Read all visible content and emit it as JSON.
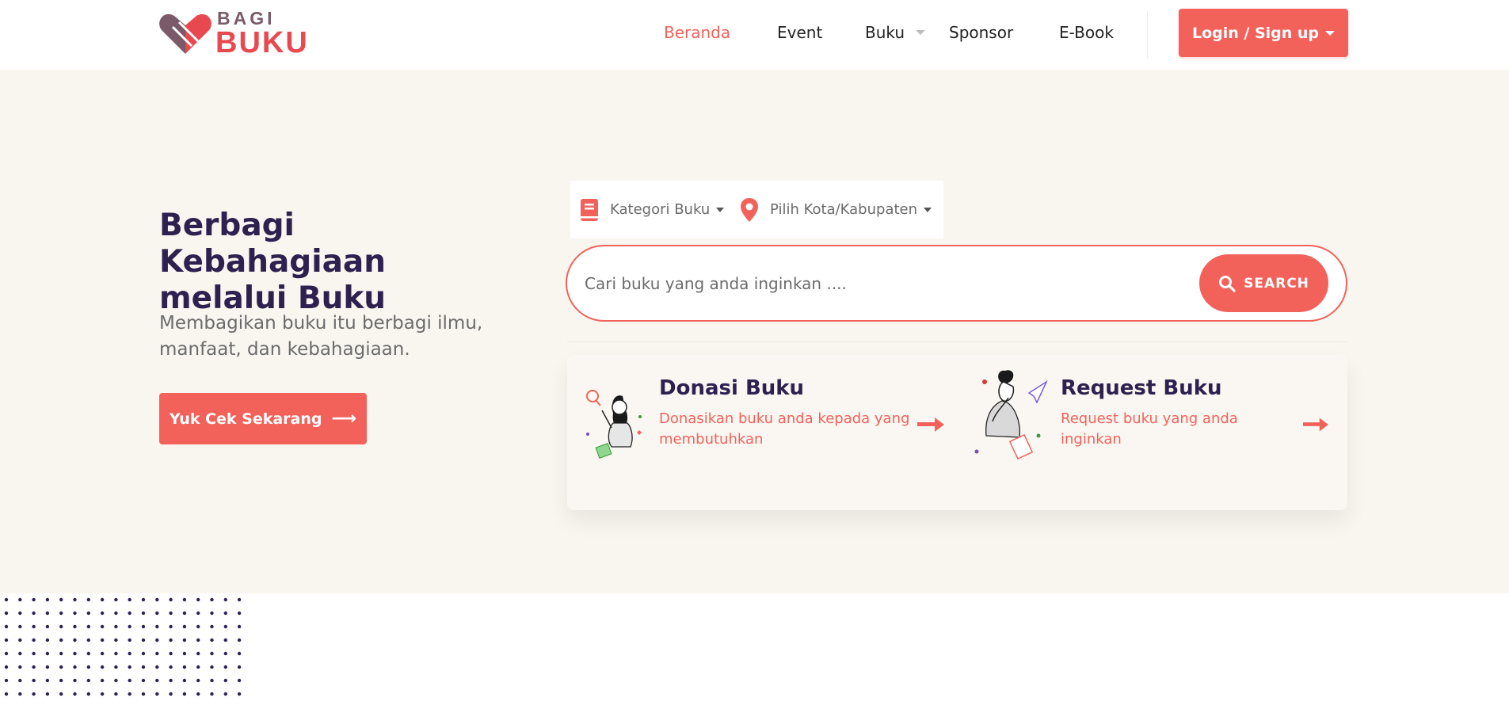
{
  "brand": {
    "logo_small": "BAGI",
    "logo_big": "BUKU"
  },
  "nav": {
    "items": [
      "Beranda",
      "Event",
      "Buku",
      "Sponsor",
      "E-Book"
    ],
    "login_label": "Login / Sign up"
  },
  "hero": {
    "title": "Berbagi Kebahagiaan melalui Buku",
    "subtitle": "Membagikan buku itu berbagi ilmu, manfaat, dan kebahagiaan.",
    "cta_label": "Yuk Cek Sekarang"
  },
  "filters": {
    "category": "Kategori Buku",
    "city": "Pilih Kota/Kabupaten"
  },
  "search": {
    "placeholder": "Cari buku yang anda inginkan ....",
    "button_label": "SEARCH"
  },
  "cards": [
    {
      "title": "Donasi Buku",
      "desc": "Donasikan buku anda kepada yang membutuhkan"
    },
    {
      "title": "Request Buku",
      "desc": "Request buku yang anda inginkan"
    }
  ],
  "colors": {
    "accent": "#f2625a",
    "heading": "#2e2150",
    "hero_bg": "#f9f6f0"
  },
  "icons": [
    "logo-heart-book-icon",
    "chevron-down-icon",
    "book-icon",
    "map-pin-icon",
    "search-icon",
    "arrow-right-icon"
  ]
}
